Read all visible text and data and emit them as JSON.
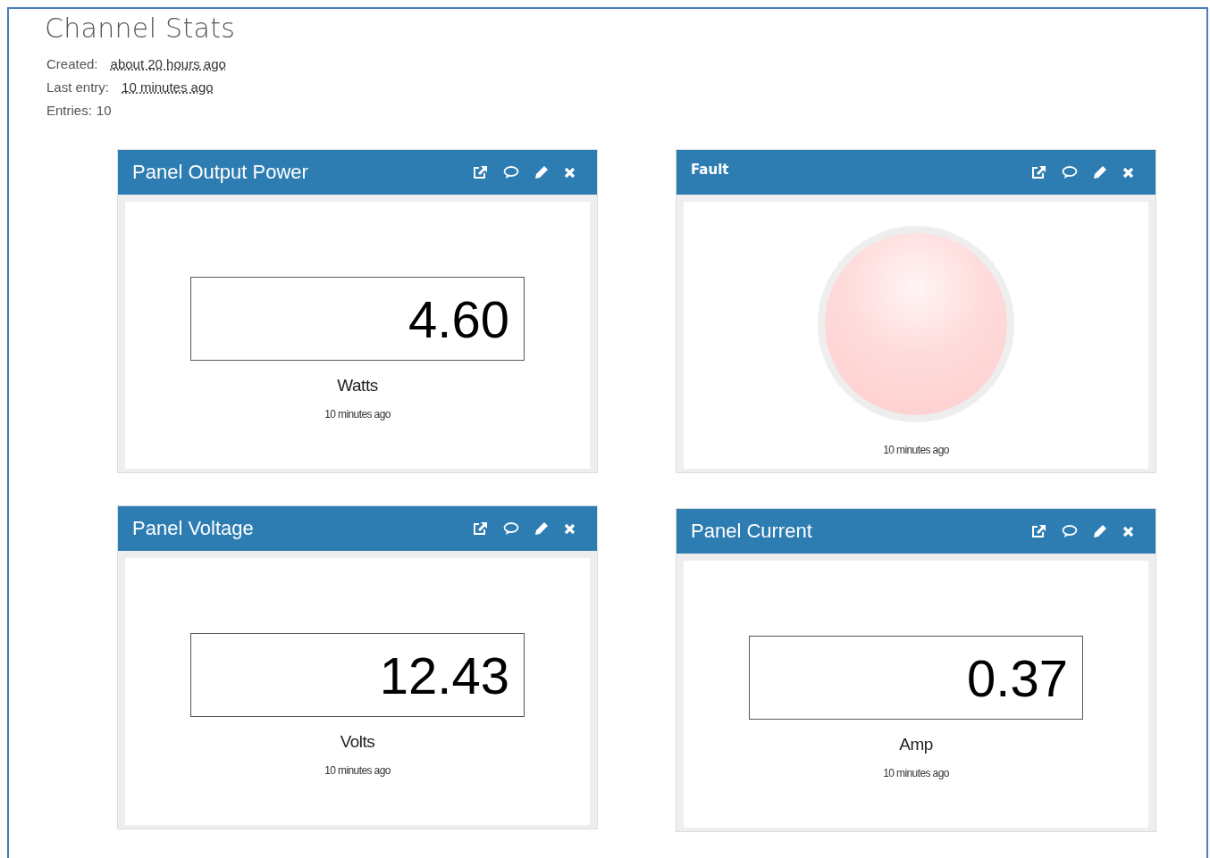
{
  "page": {
    "title": "Channel Stats"
  },
  "meta": [
    {
      "label": "Created:",
      "value": "about 20 hours ago",
      "kind": "link"
    },
    {
      "label": "Last entry:",
      "value": "10 minutes ago",
      "kind": "link"
    },
    {
      "label": "Entries:",
      "value": "10",
      "kind": "plain"
    }
  ],
  "widgets": [
    {
      "kind": "numeric",
      "title": "Panel Output Power",
      "value": "4.60",
      "unit": "Watts",
      "updated": "10 minutes ago"
    },
    {
      "kind": "lamp",
      "title": "Fault",
      "on": false,
      "updated": "10 minutes ago"
    },
    {
      "kind": "numeric",
      "title": "Panel Voltage",
      "value": "12.43",
      "unit": "Volts",
      "updated": "10 minutes ago"
    },
    {
      "kind": "numeric",
      "title": "Panel Current",
      "value": "0.37",
      "unit": "Amp",
      "updated": "10 minutes ago"
    }
  ]
}
